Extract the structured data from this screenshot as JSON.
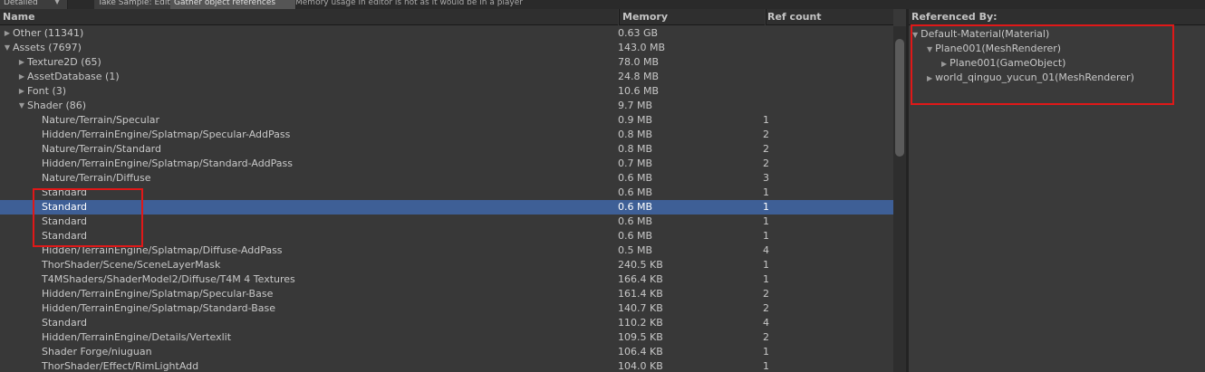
{
  "toolbar": {
    "mode": "Detailed",
    "take_sample": "Take Sample: Editor",
    "gather": "Gather object references",
    "note": "Memory usage in editor is not as it would be in a player"
  },
  "columns": {
    "name": "Name",
    "memory": "Memory",
    "ref_count": "Ref count"
  },
  "tree": [
    {
      "name": "Other (11341)",
      "memory": "0.63 GB",
      "ref": "",
      "depth": 0,
      "arrow": "collapsed"
    },
    {
      "name": "Assets (7697)",
      "memory": "143.0 MB",
      "ref": "",
      "depth": 0,
      "arrow": "expanded"
    },
    {
      "name": "Texture2D (65)",
      "memory": "78.0 MB",
      "ref": "",
      "depth": 1,
      "arrow": "collapsed"
    },
    {
      "name": "AssetDatabase (1)",
      "memory": "24.8 MB",
      "ref": "",
      "depth": 1,
      "arrow": "collapsed"
    },
    {
      "name": "Font (3)",
      "memory": "10.6 MB",
      "ref": "",
      "depth": 1,
      "arrow": "collapsed"
    },
    {
      "name": "Shader (86)",
      "memory": "9.7 MB",
      "ref": "",
      "depth": 1,
      "arrow": "expanded"
    },
    {
      "name": "Nature/Terrain/Specular",
      "memory": "0.9 MB",
      "ref": "1",
      "depth": 2,
      "arrow": "none"
    },
    {
      "name": "Hidden/TerrainEngine/Splatmap/Specular-AddPass",
      "memory": "0.8 MB",
      "ref": "2",
      "depth": 2,
      "arrow": "none"
    },
    {
      "name": "Nature/Terrain/Standard",
      "memory": "0.8 MB",
      "ref": "2",
      "depth": 2,
      "arrow": "none"
    },
    {
      "name": "Hidden/TerrainEngine/Splatmap/Standard-AddPass",
      "memory": "0.7 MB",
      "ref": "2",
      "depth": 2,
      "arrow": "none"
    },
    {
      "name": "Nature/Terrain/Diffuse",
      "memory": "0.6 MB",
      "ref": "3",
      "depth": 2,
      "arrow": "none"
    },
    {
      "name": "Standard",
      "memory": "0.6 MB",
      "ref": "1",
      "depth": 2,
      "arrow": "none"
    },
    {
      "name": "Standard",
      "memory": "0.6 MB",
      "ref": "1",
      "depth": 2,
      "arrow": "none",
      "selected": true
    },
    {
      "name": "Standard",
      "memory": "0.6 MB",
      "ref": "1",
      "depth": 2,
      "arrow": "none"
    },
    {
      "name": "Standard",
      "memory": "0.6 MB",
      "ref": "1",
      "depth": 2,
      "arrow": "none"
    },
    {
      "name": "Hidden/TerrainEngine/Splatmap/Diffuse-AddPass",
      "memory": "0.5 MB",
      "ref": "4",
      "depth": 2,
      "arrow": "none"
    },
    {
      "name": "ThorShader/Scene/SceneLayerMask",
      "memory": "240.5 KB",
      "ref": "1",
      "depth": 2,
      "arrow": "none"
    },
    {
      "name": "T4MShaders/ShaderModel2/Diffuse/T4M 4 Textures",
      "memory": "166.4 KB",
      "ref": "1",
      "depth": 2,
      "arrow": "none"
    },
    {
      "name": "Hidden/TerrainEngine/Splatmap/Specular-Base",
      "memory": "161.4 KB",
      "ref": "2",
      "depth": 2,
      "arrow": "none"
    },
    {
      "name": "Hidden/TerrainEngine/Splatmap/Standard-Base",
      "memory": "140.7 KB",
      "ref": "2",
      "depth": 2,
      "arrow": "none"
    },
    {
      "name": "Standard",
      "memory": "110.2 KB",
      "ref": "4",
      "depth": 2,
      "arrow": "none"
    },
    {
      "name": "Hidden/TerrainEngine/Details/Vertexlit",
      "memory": "109.5 KB",
      "ref": "2",
      "depth": 2,
      "arrow": "none"
    },
    {
      "name": "Shader Forge/niuguan",
      "memory": "106.4 KB",
      "ref": "1",
      "depth": 2,
      "arrow": "none"
    },
    {
      "name": "ThorShader/Effect/RimLightAdd",
      "memory": "104.0 KB",
      "ref": "1",
      "depth": 2,
      "arrow": "none"
    }
  ],
  "referenced_by": {
    "title": "Referenced By:",
    "items": [
      {
        "label": "Default-Material(Material)",
        "depth": 0,
        "arrow": "expanded"
      },
      {
        "label": "Plane001(MeshRenderer)",
        "depth": 1,
        "arrow": "expanded"
      },
      {
        "label": "Plane001(GameObject)",
        "depth": 2,
        "arrow": "collapsed"
      },
      {
        "label": "world_qinguo_yucun_01(MeshRenderer)",
        "depth": 1,
        "arrow": "collapsed"
      }
    ]
  },
  "colors": {
    "selection": "#3e5f96",
    "annotation": "#e01818",
    "background": "#383838"
  }
}
